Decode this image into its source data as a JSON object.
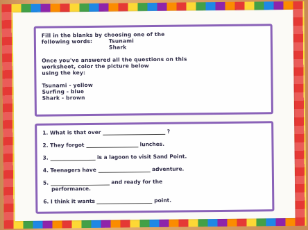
{
  "instructions": {
    "line1": "Fill in the blanks by choosing one of the",
    "line2": "following words:",
    "word1": "Tsunami",
    "word2": "Shark",
    "line5": "Once you've answered all the questions on this",
    "line6": "worksheet, color the picture below",
    "line7": "using the key:"
  },
  "key": [
    {
      "label": "Tsunami - yellow"
    },
    {
      "label": "Surfing - blue"
    },
    {
      "label": "Shark - brown"
    }
  ],
  "questions": [
    {
      "num": "1.",
      "before": "What is that over",
      "after": "?"
    },
    {
      "num": "2.",
      "before": "They forgot",
      "after": "lunches."
    },
    {
      "num": "3.",
      "before": "",
      "after": "is a lagoon to visit Sand Point."
    },
    {
      "num": "4.",
      "before": "Teenagers have",
      "after": "adventure."
    },
    {
      "num": "5.",
      "before": "",
      "after": "and ready for the"
    },
    {
      "num": "",
      "before": "performance.",
      "after": ""
    },
    {
      "num": "6.",
      "before": "I think it wants",
      "after": "point."
    }
  ],
  "colors": {
    "border": "#8a62b8"
  }
}
